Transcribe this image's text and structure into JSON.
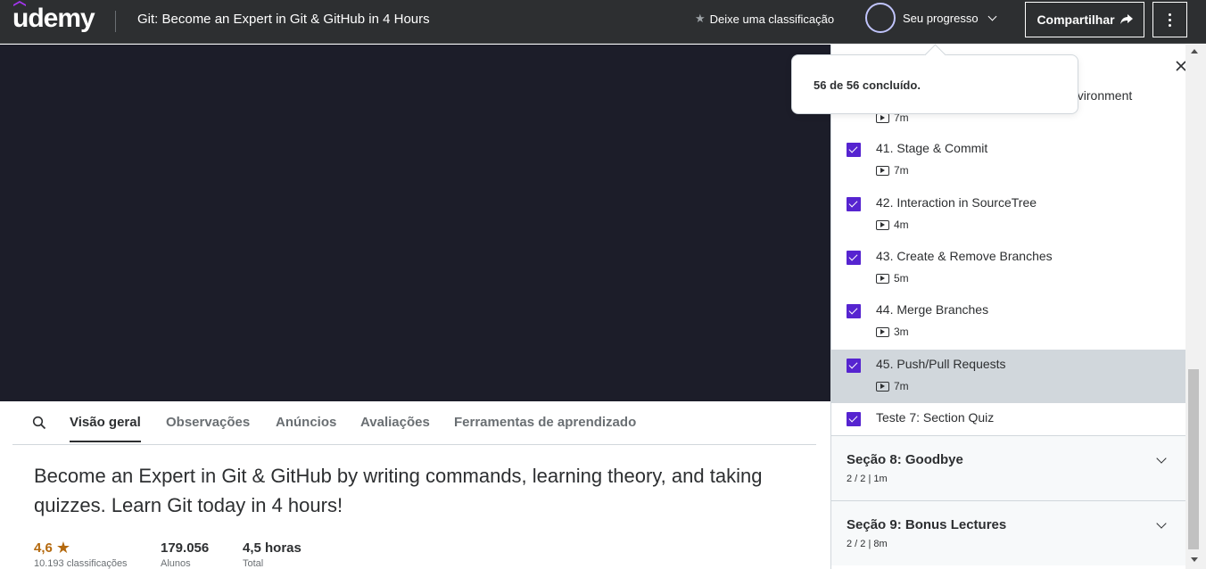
{
  "header": {
    "logo": "udemy",
    "course_title": "Git: Become an Expert in Git & GitHub in 4 Hours",
    "rate_label": "Deixe uma classificação",
    "progress_label": "Seu progresso",
    "share_label": "Compartilhar"
  },
  "progress_popover": {
    "text": "56 de 56 concluído."
  },
  "tabs": [
    {
      "label": "Visão geral",
      "active": true
    },
    {
      "label": "Observações",
      "active": false
    },
    {
      "label": "Anúncios",
      "active": false
    },
    {
      "label": "Avaliações",
      "active": false
    },
    {
      "label": "Ferramentas de aprendizado",
      "active": false
    }
  ],
  "overview": {
    "headline": "Become an Expert in Git & GitHub by writing commands, learning theory, and taking quizzes. Learn Git today in 4 hours!",
    "rating": "4,6",
    "rating_label": "10.193 classificações",
    "students": "179.056",
    "students_label": "Alunos",
    "hours": "4,5 horas",
    "hours_label": "Total"
  },
  "sidebar": {
    "partial_item": {
      "title_fragment": "nvironment",
      "duration": "7m"
    },
    "items": [
      {
        "title": "41. Stage & Commit",
        "duration": "7m",
        "checked": true,
        "active": false
      },
      {
        "title": "42. Interaction in SourceTree",
        "duration": "4m",
        "checked": true,
        "active": false
      },
      {
        "title": "43. Create & Remove Branches",
        "duration": "5m",
        "checked": true,
        "active": false
      },
      {
        "title": "44. Merge Branches",
        "duration": "3m",
        "checked": true,
        "active": false
      },
      {
        "title": "45. Push/Pull Requests",
        "duration": "7m",
        "checked": true,
        "active": true
      }
    ],
    "quiz": {
      "title": "Teste 7: Section Quiz",
      "checked": true
    },
    "sections": [
      {
        "title": "Seção 8: Goodbye",
        "meta": "2 / 2 | 1m"
      },
      {
        "title": "Seção 9: Bonus Lectures",
        "meta": "2 / 2 | 8m"
      }
    ]
  },
  "colors": {
    "header_bg": "#2d2f31",
    "video_bg": "#1c1d29",
    "checkbox": "#5624d0",
    "rating": "#b4690e",
    "active_item": "#d1d7dc"
  }
}
